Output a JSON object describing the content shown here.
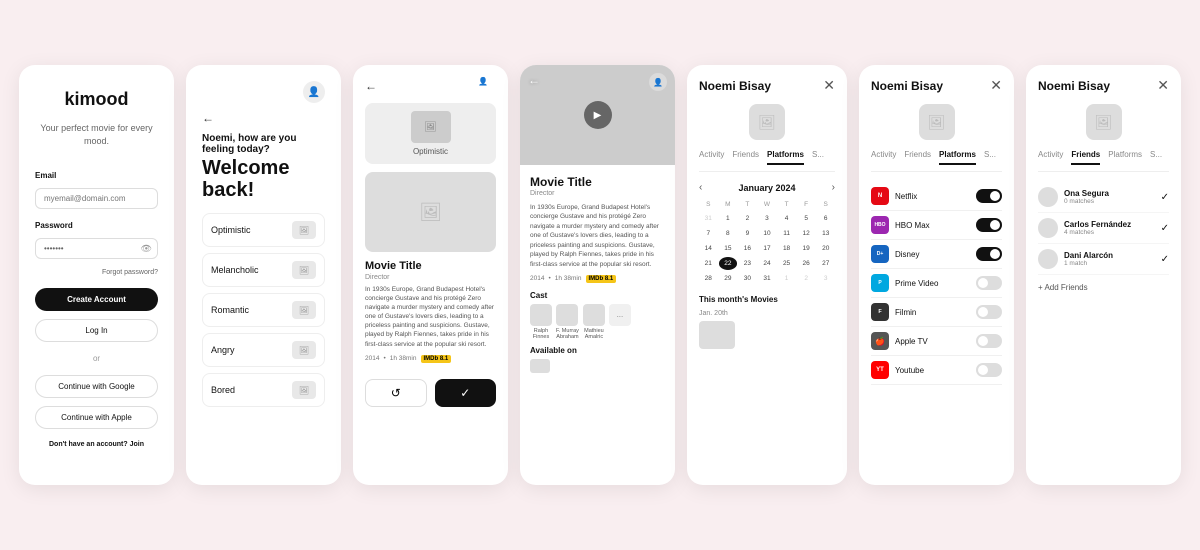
{
  "app": {
    "name": "kimood",
    "tagline": "Your perfect movie for every mood."
  },
  "screen1": {
    "logo": "kimood",
    "tagline": "Your perfect movie for every mood.",
    "email_label": "Email",
    "email_placeholder": "myemail@domain.com",
    "password_label": "Password",
    "password_value": "•••••••",
    "forgot": "Forgot password?",
    "create_account": "Create Account",
    "login": "Log In",
    "or": "or",
    "google": "Continue with Google",
    "apple": "Continue with Apple",
    "signup_text": "Don't have an account?",
    "signup_link": "Join"
  },
  "screen2": {
    "greeting": "Noemi, how are you feeling today?",
    "back_label": "←",
    "welcome_line1": "Welcome",
    "welcome_line2": "back!",
    "moods": [
      "Optimistic",
      "Melancholic",
      "Romantic",
      "Angry",
      "Bored"
    ]
  },
  "screen3": {
    "selected_mood": "Optimistic",
    "movie_title": "Movie Title",
    "movie_role": "Director",
    "movie_desc": "In 1930s Europe, Grand Budapest Hotel's concierge Gustave and his protégé Zero navigate a murder mystery and comedy after one of Gustave's lovers dies, leading to a priceless painting and suspicions. Gustave, played by Ralph Fiennes, takes pride in his first-class service at the popular ski resort.",
    "year": "2014",
    "duration": "1h 38min",
    "imdb": "IMDb 8.1",
    "action_refresh": "↺",
    "action_confirm": "✓"
  },
  "screen4": {
    "movie_title": "Movie Title",
    "director": "Director",
    "desc": "In 1930s Europe, Grand Budapest Hotel's concierge Gustave and his protégé Zero navigate a murder mystery and comedy after one of Gustave's lovers dies, leading to a priceless painting and suspicions. Gustave, played by Ralph Fiennes, takes pride in his first-class service at the popular ski resort.",
    "year": "2014",
    "duration": "1h 38min",
    "imdb": "IMDb 8.1",
    "cast_label": "Cast",
    "cast": [
      {
        "name": "Ralph\nFinnes"
      },
      {
        "name": "F. Murray\nAbraham"
      },
      {
        "name": "Mathieu\nAmalric"
      },
      {
        "name": "..."
      }
    ],
    "available_label": "Available on"
  },
  "screen5": {
    "profile_name": "Noemi Bisay",
    "tabs": [
      "Activity",
      "Friends",
      "Platforms",
      "S..."
    ],
    "calendar_month": "January 2024",
    "calendar_days": [
      "S",
      "M",
      "T",
      "W",
      "T",
      "F",
      "S"
    ],
    "calendar_weeks": [
      [
        "31",
        "1",
        "2",
        "3",
        "4",
        "5",
        "6"
      ],
      [
        "7",
        "8",
        "9",
        "10",
        "11",
        "12",
        "13"
      ],
      [
        "14",
        "15",
        "16",
        "17",
        "18",
        "19",
        "20"
      ],
      [
        "21",
        "22",
        "23",
        "24",
        "25",
        "26",
        "27"
      ],
      [
        "28",
        "29",
        "30",
        "31",
        "1",
        "2",
        "3"
      ]
    ],
    "today": "22",
    "this_month_label": "This month's Movies",
    "date_label": "Jan. 20th"
  },
  "screen6": {
    "profile_name": "Noemi Bisay",
    "tabs": [
      "Activity",
      "Friends",
      "Platforms",
      "S..."
    ],
    "platforms": [
      {
        "name": "Netflix",
        "on": true,
        "logo": "N"
      },
      {
        "name": "HBO Max",
        "on": true,
        "logo": "HBO"
      },
      {
        "name": "Disney",
        "on": true,
        "logo": "D+"
      },
      {
        "name": "Prime Video",
        "on": false,
        "logo": "P"
      },
      {
        "name": "Filmin",
        "on": false,
        "logo": "F"
      },
      {
        "name": "Apple TV",
        "on": false,
        "logo": ""
      },
      {
        "name": "Youtube",
        "on": false,
        "logo": "YT"
      }
    ],
    "active_tab": "Platforms"
  },
  "screen7": {
    "profile_name": "Noemi Bisay",
    "tabs": [
      "Activity",
      "Friends",
      "Platforms",
      "S..."
    ],
    "friends": [
      {
        "name": "Ona Segura",
        "matches": "0 matches",
        "added": true
      },
      {
        "name": "Carlos Fernández",
        "matches": "4 matches",
        "added": true
      },
      {
        "name": "Dani Alarcón",
        "matches": "1 match",
        "added": true
      }
    ],
    "add_friends": "+ Add Friends",
    "active_tab": "Friends"
  }
}
